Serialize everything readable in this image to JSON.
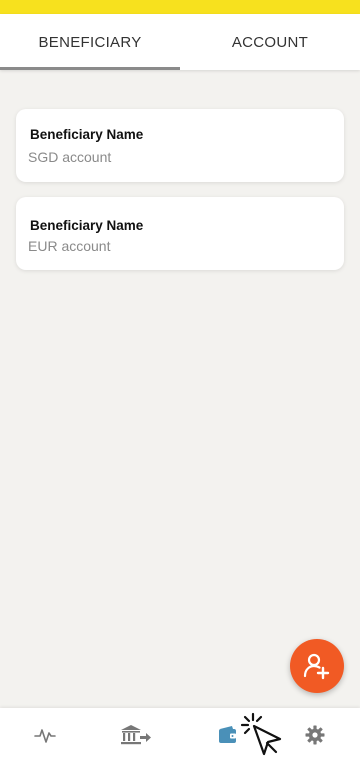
{
  "tabs": [
    {
      "label": "BENEFICIARY",
      "active": true
    },
    {
      "label": "ACCOUNT",
      "active": false
    }
  ],
  "beneficiaries": [
    {
      "name": "Beneficiary Name",
      "account": "SGD account"
    },
    {
      "name": "Beneficiary Name",
      "account": "EUR account"
    }
  ],
  "fab": {
    "icon": "add-user-icon"
  },
  "bottom_nav": [
    {
      "icon": "activity-icon",
      "active": false
    },
    {
      "icon": "bank-transfer-icon",
      "active": false
    },
    {
      "icon": "wallet-icon",
      "active": true
    },
    {
      "icon": "settings-icon",
      "active": false
    }
  ],
  "colors": {
    "status_strip": "#f7e11e",
    "fab": "#f15a24",
    "active_nav": "#4a90b8",
    "inactive_nav": "#777777",
    "background": "#f3f2ef"
  }
}
